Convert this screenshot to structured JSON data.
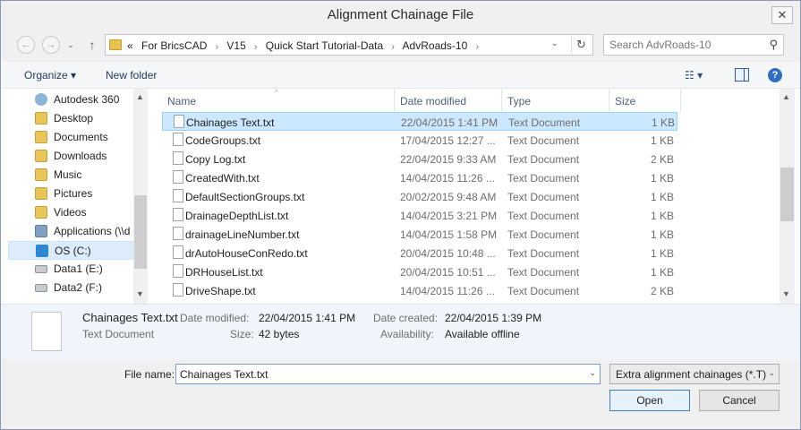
{
  "window": {
    "title": "Alignment Chainage File",
    "close_glyph": "✕"
  },
  "address_bar": {
    "overflow_glyph": "«",
    "crumbs": [
      "For BricsCAD",
      "V15",
      "Quick Start Tutorial-Data",
      "AdvRoads-10"
    ],
    "separator": "›",
    "dropdown_glyph": "⌄",
    "refresh_glyph": "↻",
    "back_glyph": "←",
    "forward_glyph": "→",
    "up_glyph": "↑"
  },
  "search": {
    "placeholder": "Search AdvRoads-10",
    "icon_glyph": "⚲"
  },
  "toolbar": {
    "organize_label": "Organize ▾",
    "new_folder_label": "New folder",
    "view_glyph": "☷ ▾",
    "help_glyph": "?"
  },
  "nav_pane": {
    "items": [
      {
        "label": "Autodesk 360",
        "icon": "cloud-icon"
      },
      {
        "label": "Desktop",
        "icon": "folder-icon"
      },
      {
        "label": "Documents",
        "icon": "folder-icon"
      },
      {
        "label": "Downloads",
        "icon": "folder-icon"
      },
      {
        "label": "Music",
        "icon": "folder-icon"
      },
      {
        "label": "Pictures",
        "icon": "folder-icon"
      },
      {
        "label": "Videos",
        "icon": "folder-icon"
      },
      {
        "label": "Applications (\\\\d",
        "icon": "network-drive-icon"
      },
      {
        "label": "OS (C:)",
        "icon": "windows-drive-icon"
      },
      {
        "label": "Data1 (E:)",
        "icon": "drive-icon"
      },
      {
        "label": "Data2 (F:)",
        "icon": "drive-icon"
      }
    ],
    "selected_index": 8
  },
  "file_list": {
    "columns": [
      "Name",
      "Date modified",
      "Type",
      "Size"
    ],
    "sort_glyph": "^",
    "rows": [
      {
        "name": "Chainages Text.txt",
        "date": "22/04/2015 1:41 PM",
        "type": "Text Document",
        "size": "1 KB"
      },
      {
        "name": "CodeGroups.txt",
        "date": "17/04/2015 12:27 ...",
        "type": "Text Document",
        "size": "1 KB"
      },
      {
        "name": "Copy Log.txt",
        "date": "22/04/2015 9:33 AM",
        "type": "Text Document",
        "size": "2 KB"
      },
      {
        "name": "CreatedWith.txt",
        "date": "14/04/2015 11:26 ...",
        "type": "Text Document",
        "size": "1 KB"
      },
      {
        "name": "DefaultSectionGroups.txt",
        "date": "20/02/2015 9:48 AM",
        "type": "Text Document",
        "size": "1 KB"
      },
      {
        "name": "DrainageDepthList.txt",
        "date": "14/04/2015 3:21 PM",
        "type": "Text Document",
        "size": "1 KB"
      },
      {
        "name": "drainageLineNumber.txt",
        "date": "14/04/2015 1:58 PM",
        "type": "Text Document",
        "size": "1 KB"
      },
      {
        "name": "drAutoHouseConRedo.txt",
        "date": "20/04/2015 10:48 ...",
        "type": "Text Document",
        "size": "1 KB"
      },
      {
        "name": "DRHouseList.txt",
        "date": "20/04/2015 10:51 ...",
        "type": "Text Document",
        "size": "1 KB"
      },
      {
        "name": "DriveShape.txt",
        "date": "14/04/2015 11:26 ...",
        "type": "Text Document",
        "size": "2 KB"
      }
    ],
    "selected_index": 0
  },
  "details": {
    "file_name": "Chainages Text.txt",
    "file_type": "Text Document",
    "date_modified_label": "Date modified:",
    "date_modified": "22/04/2015 1:41 PM",
    "size_label": "Size:",
    "size": "42 bytes",
    "date_created_label": "Date created:",
    "date_created": "22/04/2015 1:39 PM",
    "availability_label": "Availability:",
    "availability": "Available offline"
  },
  "bottom": {
    "file_name_label": "File name:",
    "file_name_value": "Chainages Text.txt",
    "filter_label": "Extra alignment chainages (*.T)",
    "open_label": "Open",
    "cancel_label": "Cancel",
    "dropdown_glyph": "⌄"
  },
  "scroll": {
    "up_glyph": "▲",
    "down_glyph": "▼"
  }
}
